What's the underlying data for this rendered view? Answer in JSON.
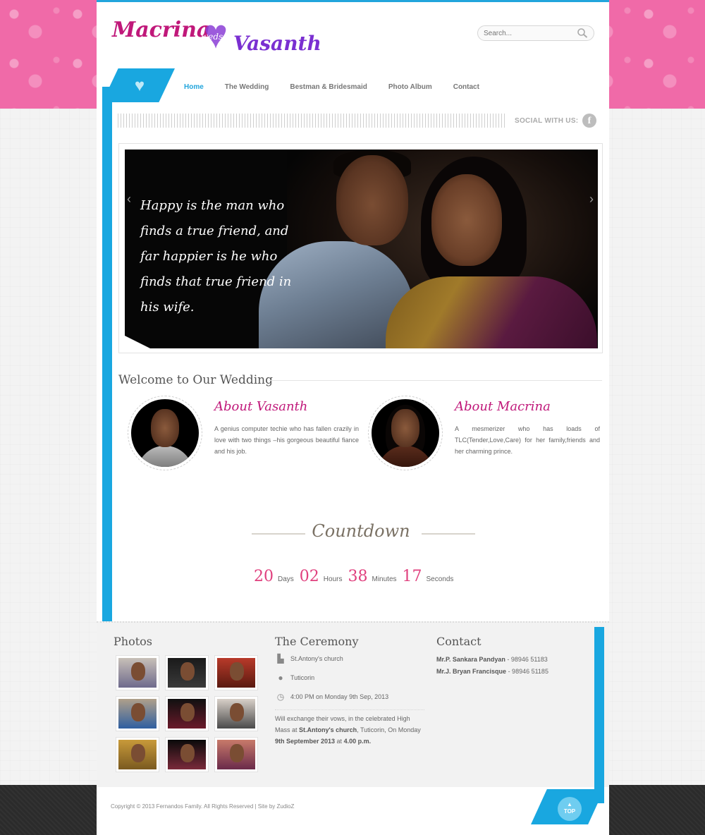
{
  "logo": {
    "name1": "Macrina",
    "weds": "weds",
    "name2": "Vasanth"
  },
  "search": {
    "placeholder": "Search..."
  },
  "nav": {
    "items": [
      {
        "label": "Home"
      },
      {
        "label": "The Wedding"
      },
      {
        "label": "Bestman & Bridesmaid"
      },
      {
        "label": "Photo Album"
      },
      {
        "label": "Contact"
      }
    ]
  },
  "social": {
    "label": "SOCIAL WITH US:",
    "fb": "f"
  },
  "slider": {
    "quote": "Happy is the man who finds a true friend, and far happier is he who finds that true friend in his wife.",
    "prev": "‹",
    "next": "›"
  },
  "welcome": {
    "title": "Welcome to Our Wedding",
    "vasanth": {
      "heading": "About Vasanth",
      "text": "A genius computer techie who has fallen crazily in love with two things –his gorgeous beautiful fiance and his job."
    },
    "macrina": {
      "heading": "About Macrina",
      "text": "A mesmerizer who has loads of TLC(Tender,Love,Care) for her family,friends and her charming prince."
    }
  },
  "countdown": {
    "title": "Countdown",
    "days": "20",
    "days_label": "Days",
    "hours": "02",
    "hours_label": "Hours",
    "minutes": "38",
    "minutes_label": "Minutes",
    "seconds": "17",
    "seconds_label": "Seconds"
  },
  "footer": {
    "photos_title": "Photos",
    "ceremony_title": "The Ceremony",
    "contact_title": "Contact",
    "ceremony": {
      "place": "St.Antony's church",
      "city": "Tuticorin",
      "time": "4:00 PM",
      "date_text": "on Monday 9th Sep, 2013",
      "desc_1": "Will exchange their vows, in the celebrated High Mass at ",
      "desc_church": "St.Antony's church",
      "desc_2": ", Tuticorin, On Monday ",
      "desc_date": "9th September 2013",
      "desc_3": " at ",
      "desc_time": "4.00 p.m."
    },
    "contacts": [
      {
        "name": "Mr.P. Sankara Pandyan",
        "phone": "-  98946 51183"
      },
      {
        "name": "Mr.J. Bryan Francisque",
        "phone": "-  98946 51185"
      }
    ],
    "copyright": "Copyright © 2013 Fernandos Family. All Rights Reserved | Site by ZudioZ",
    "top": "TOP"
  },
  "colors": {
    "accent_blue": "#19a7e0",
    "pink": "#c0187a",
    "countdown_pink": "#e0407e",
    "bg_pink": "#f06aa8"
  }
}
